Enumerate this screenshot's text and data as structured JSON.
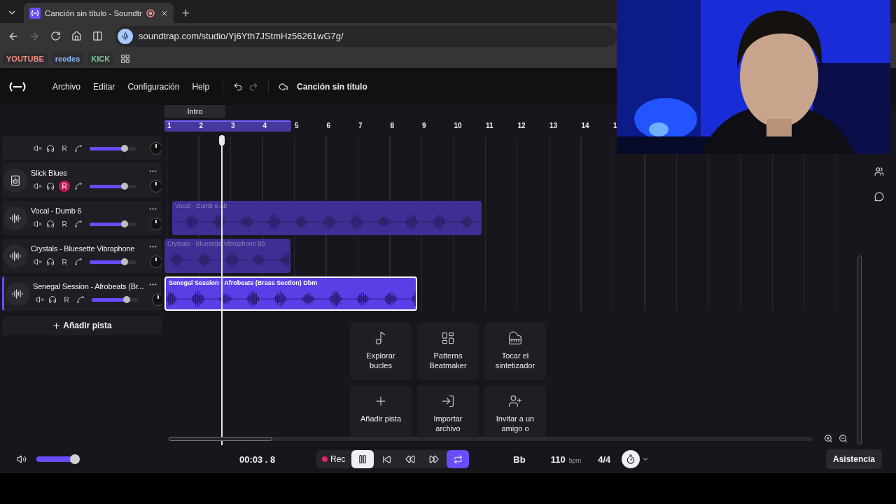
{
  "browser": {
    "tabs": [
      {
        "title": "Canción sin título - Soundtr",
        "selected": true,
        "recording": true
      }
    ],
    "url": "soundtrap.com/studio/Yj6Yth7JStmHz56261wG7g/",
    "forward_disabled": true,
    "bookmarks": [
      {
        "label": "YOUTUBE",
        "color": "#f28b82"
      },
      {
        "label": "reedes",
        "color": "#8ab4f8"
      },
      {
        "label": "KICK",
        "color": "#81c995"
      }
    ]
  },
  "menu": {
    "items": [
      "Archivo",
      "Editar",
      "Configuración",
      "Help"
    ],
    "redo_disabled": true,
    "song_title": "Canción sin título"
  },
  "timeline": {
    "section": "Intro",
    "bars": [
      "1",
      "2",
      "3",
      "4",
      "5",
      "6",
      "7",
      "8",
      "9",
      "10",
      "11",
      "12",
      "13",
      "14",
      "1"
    ]
  },
  "tracks": [
    {
      "kind": "partial",
      "record_label": "R",
      "record_armed": false,
      "selected": false,
      "volume": {
        "level": 0.76
      }
    },
    {
      "kind": "beat",
      "name": "Slick Blues",
      "record_label": "R",
      "record_armed": true,
      "selected": false,
      "volume": {
        "level": 0.76
      }
    },
    {
      "kind": "audio",
      "name": "Vocal - Dumb 6",
      "record_label": "R",
      "record_armed": false,
      "selected": false,
      "volume": {
        "level": 0.76
      },
      "clip": {
        "label": "Vocal - Dumb 6 Ab",
        "selected": false
      }
    },
    {
      "kind": "audio",
      "name": "Crystals - Bluesette Vibraphone",
      "record_label": "R",
      "record_armed": false,
      "selected": false,
      "volume": {
        "level": 0.76
      },
      "clip": {
        "label": "Crystals - Bluesette Vibraphone Bb",
        "selected": false
      }
    },
    {
      "kind": "audio",
      "name": "Senegal Session - Afrobeats (Br...",
      "record_label": "R",
      "record_armed": false,
      "selected": true,
      "volume": {
        "level": 0.76
      },
      "clip": {
        "label": "Senegal Session - Afrobeats (Brass Section) Dbm",
        "selected": true
      }
    }
  ],
  "add_track": "Añadir pista",
  "actions": [
    {
      "kind": "loops",
      "label": "Explorar\nbucles"
    },
    {
      "kind": "patterns",
      "label": "Patterns\nBeatmaker"
    },
    {
      "kind": "synth",
      "label": "Tocar el\nsintetizador"
    },
    {
      "kind": "add",
      "label": "Añadir pista"
    },
    {
      "kind": "import",
      "label": "Importar\narchivo"
    },
    {
      "kind": "invite",
      "label": "Invitar a un\namigo o"
    }
  ],
  "transport": {
    "master_volume": {
      "level": 0.88
    },
    "time": "00:03 . 8",
    "rec": "Rec",
    "playing": true,
    "loop": true,
    "key": "Bb",
    "tempo": "110",
    "tempo_unit": "bpm",
    "signature": "4/4",
    "metronome": true,
    "assist": "Asistencia"
  }
}
